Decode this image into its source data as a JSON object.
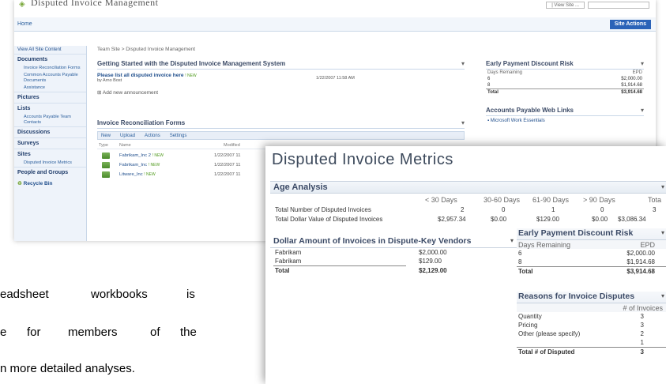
{
  "back_window": {
    "title": "Disputed Invoice Management",
    "top_right_label": "| View Site ...",
    "home_label": "Home",
    "site_actions": "Site Actions",
    "breadcrumb": "Team Site > Disputed Invoice Management",
    "quick_launch": {
      "view_all": "View All Site Content",
      "sections": [
        {
          "head": "Documents",
          "items": [
            "Invoice Reconciliation Forms",
            "Common Accounts Payable Documents",
            "Assistance"
          ]
        },
        {
          "head": "Pictures",
          "items": []
        },
        {
          "head": "Lists",
          "items": [
            "Accounts Payable Team Contacts"
          ]
        },
        {
          "head": "Discussions",
          "items": []
        },
        {
          "head": "Surveys",
          "items": []
        },
        {
          "head": "Sites",
          "items": [
            "Disputed Invoice Metrics"
          ]
        },
        {
          "head": "People and Groups",
          "items": []
        }
      ],
      "recycle_bin": "Recycle Bin"
    },
    "announcements": {
      "title": "Getting Started with the Disputed Invoice Management System",
      "link": "Please list all disputed invoice here",
      "new_tag": "! NEW",
      "by": "by Arno Bost",
      "date": "1/22/2007 11:58 AM",
      "add": "Add new announcement"
    },
    "forms": {
      "title": "Invoice Reconciliation Forms",
      "toolbar": [
        "New",
        "Upload",
        "Actions",
        "Settings"
      ],
      "col_type": "Type",
      "col_name": "Name",
      "col_modified": "Modified",
      "rows": [
        {
          "name": "Fabrikam_Inc 2",
          "new": "! NEW",
          "modified": "1/22/2007 11"
        },
        {
          "name": "Fabrikam_Inc",
          "new": "! NEW",
          "modified": "1/22/2007 11"
        },
        {
          "name": "Litware_Inc",
          "new": "! NEW",
          "modified": "1/22/2007 11"
        }
      ]
    },
    "epd_small": {
      "title": "Early Payment Discount Risk",
      "header": [
        "Days Remaining",
        "EPD"
      ],
      "rows": [
        [
          "6",
          "$2,000.00"
        ],
        [
          "8",
          "$1,914.68"
        ]
      ],
      "total": [
        "Total",
        "$3,914.68"
      ]
    },
    "links": {
      "title": "Accounts Payable Web Links",
      "item": "Microsoft Work Essentials"
    }
  },
  "front_window": {
    "title": "Disputed Invoice Metrics",
    "age": {
      "title": "Age Analysis",
      "headers": [
        "< 30 Days",
        "30-60 Days",
        "61-90 Days",
        "> 90 Days",
        "Tota"
      ],
      "rows": [
        {
          "label": "Total Number of Disputed Invoices",
          "values": [
            "2",
            "0",
            "1",
            "0",
            "3"
          ]
        },
        {
          "label": "Total Dollar Value of Disputed Invoices",
          "values": [
            "$2,957.34",
            "$0.00",
            "$129.00",
            "$0.00",
            "$3,086.34"
          ]
        }
      ]
    },
    "dollar": {
      "title": "Dollar Amount of Invoices in Dispute-Key Vendors",
      "rows": [
        [
          "Fabrikam",
          "$2,000.00"
        ],
        [
          "Fabrikam",
          "$129.00"
        ]
      ],
      "total": [
        "Total",
        "$2,129.00"
      ]
    },
    "epd": {
      "title": "Early Payment Discount Risk",
      "header": [
        "Days Remaining",
        "EPD"
      ],
      "rows": [
        [
          "6",
          "$2,000.00"
        ],
        [
          "8",
          "$1,914.68"
        ]
      ],
      "total": [
        "Total",
        "$3,914.68"
      ]
    },
    "reasons": {
      "title": "Reasons for Invoice Disputes",
      "header": "# of Invoices",
      "rows": [
        [
          "Quantity",
          "3"
        ],
        [
          "Pricing",
          "3"
        ],
        [
          "Other (please specify)",
          "2"
        ],
        [
          "",
          "1"
        ]
      ],
      "total": [
        "Total # of Disputed",
        "3"
      ]
    }
  },
  "paragraph": {
    "line1_a": "eadsheet",
    "line1_b": "workbooks",
    "line1_c": "is",
    "line2_a": "e",
    "line2_b": "for",
    "line2_c": "members",
    "line2_d": "of",
    "line2_e": "the",
    "line3": "n more detailed analyses."
  }
}
